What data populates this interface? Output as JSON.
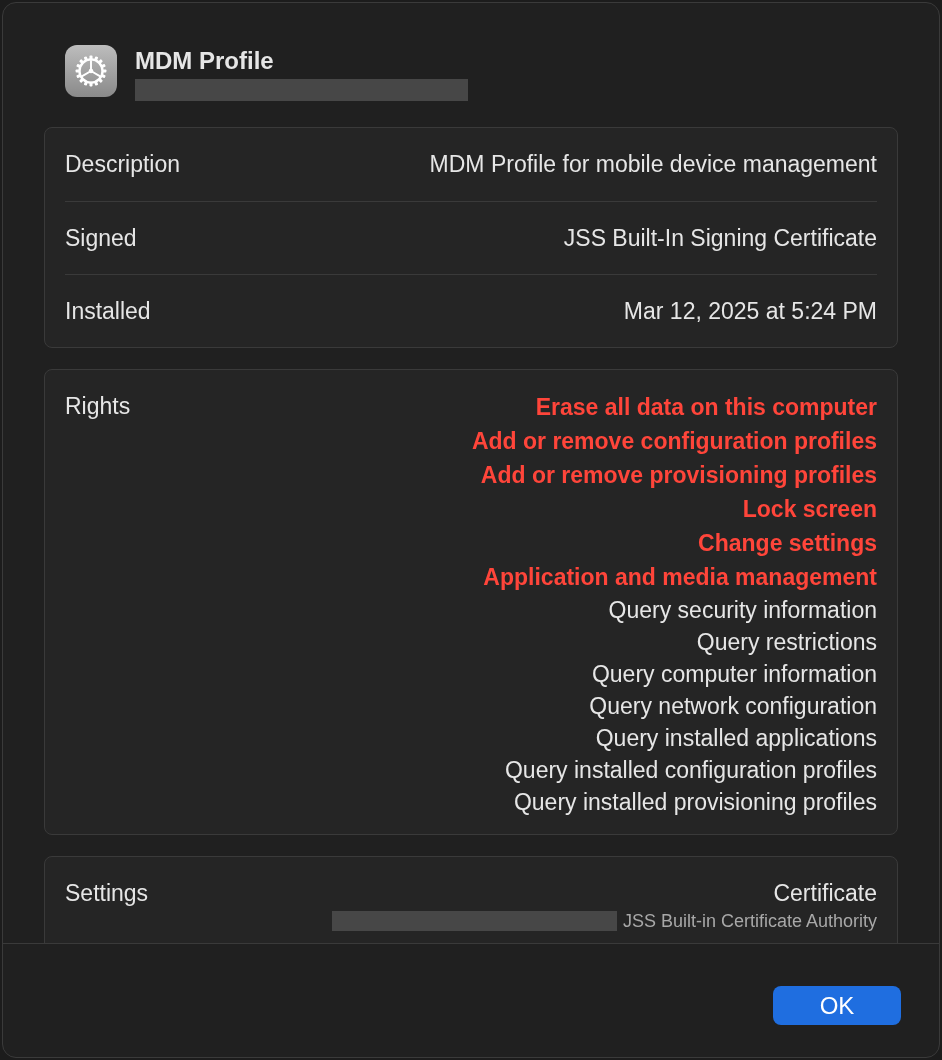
{
  "header": {
    "title": "MDM Profile"
  },
  "details": [
    {
      "label": "Description",
      "value": "MDM Profile for mobile device management"
    },
    {
      "label": "Signed",
      "value": "JSS Built-In Signing Certificate"
    },
    {
      "label": "Installed",
      "value": "Mar 12, 2025 at 5:24 PM"
    }
  ],
  "rights": {
    "label": "Rights",
    "items": [
      {
        "text": "Erase all data on this computer",
        "warning": true
      },
      {
        "text": "Add or remove configuration profiles",
        "warning": true
      },
      {
        "text": "Add or remove provisioning profiles",
        "warning": true
      },
      {
        "text": "Lock screen",
        "warning": true
      },
      {
        "text": "Change settings",
        "warning": true
      },
      {
        "text": "Application and media management",
        "warning": true
      },
      {
        "text": "Query security information",
        "warning": false
      },
      {
        "text": "Query restrictions",
        "warning": false
      },
      {
        "text": "Query computer information",
        "warning": false
      },
      {
        "text": "Query network configuration",
        "warning": false
      },
      {
        "text": "Query installed applications",
        "warning": false
      },
      {
        "text": "Query installed configuration profiles",
        "warning": false
      },
      {
        "text": "Query installed provisioning profiles",
        "warning": false
      }
    ]
  },
  "settings": {
    "label": "Settings",
    "title": "Certificate",
    "issuer": "JSS Built-in Certificate Authority"
  },
  "buttons": [
    {
      "label": "OK"
    }
  ]
}
